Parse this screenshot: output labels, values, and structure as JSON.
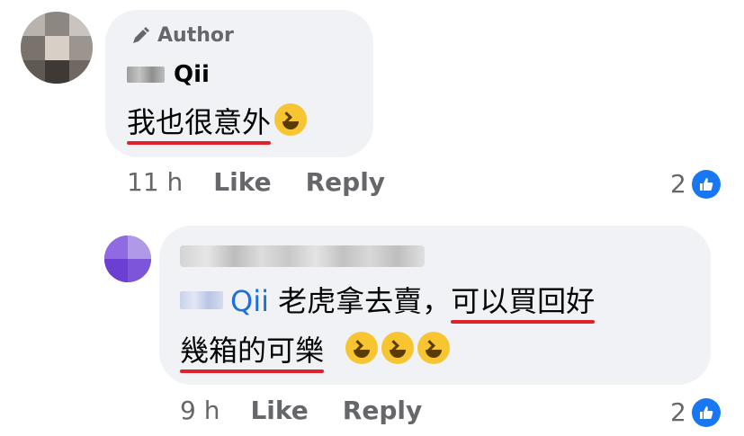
{
  "comments": [
    {
      "badge": "Author",
      "name": "Qii",
      "text_plain": "",
      "text_underlined": "我也很意外",
      "emoji": "laughing-face",
      "time": "11 h",
      "like_label": "Like",
      "reply_label": "Reply",
      "reaction_count": "2"
    },
    {
      "mention": "Qii",
      "text_plain": "老虎拿去賣，",
      "text_underlined_1": "可以買回好",
      "text_underlined_2": "幾箱的可樂",
      "emoji": "rolling-on-floor-laughing",
      "time": "9 h",
      "like_label": "Like",
      "reply_label": "Reply",
      "reaction_count": "2"
    }
  ],
  "colors": {
    "bubble": "#f0f2f5",
    "meta_text": "#65676b",
    "mention": "#216fdb",
    "underline": "#e0222a",
    "like_badge": "#1877f2"
  }
}
